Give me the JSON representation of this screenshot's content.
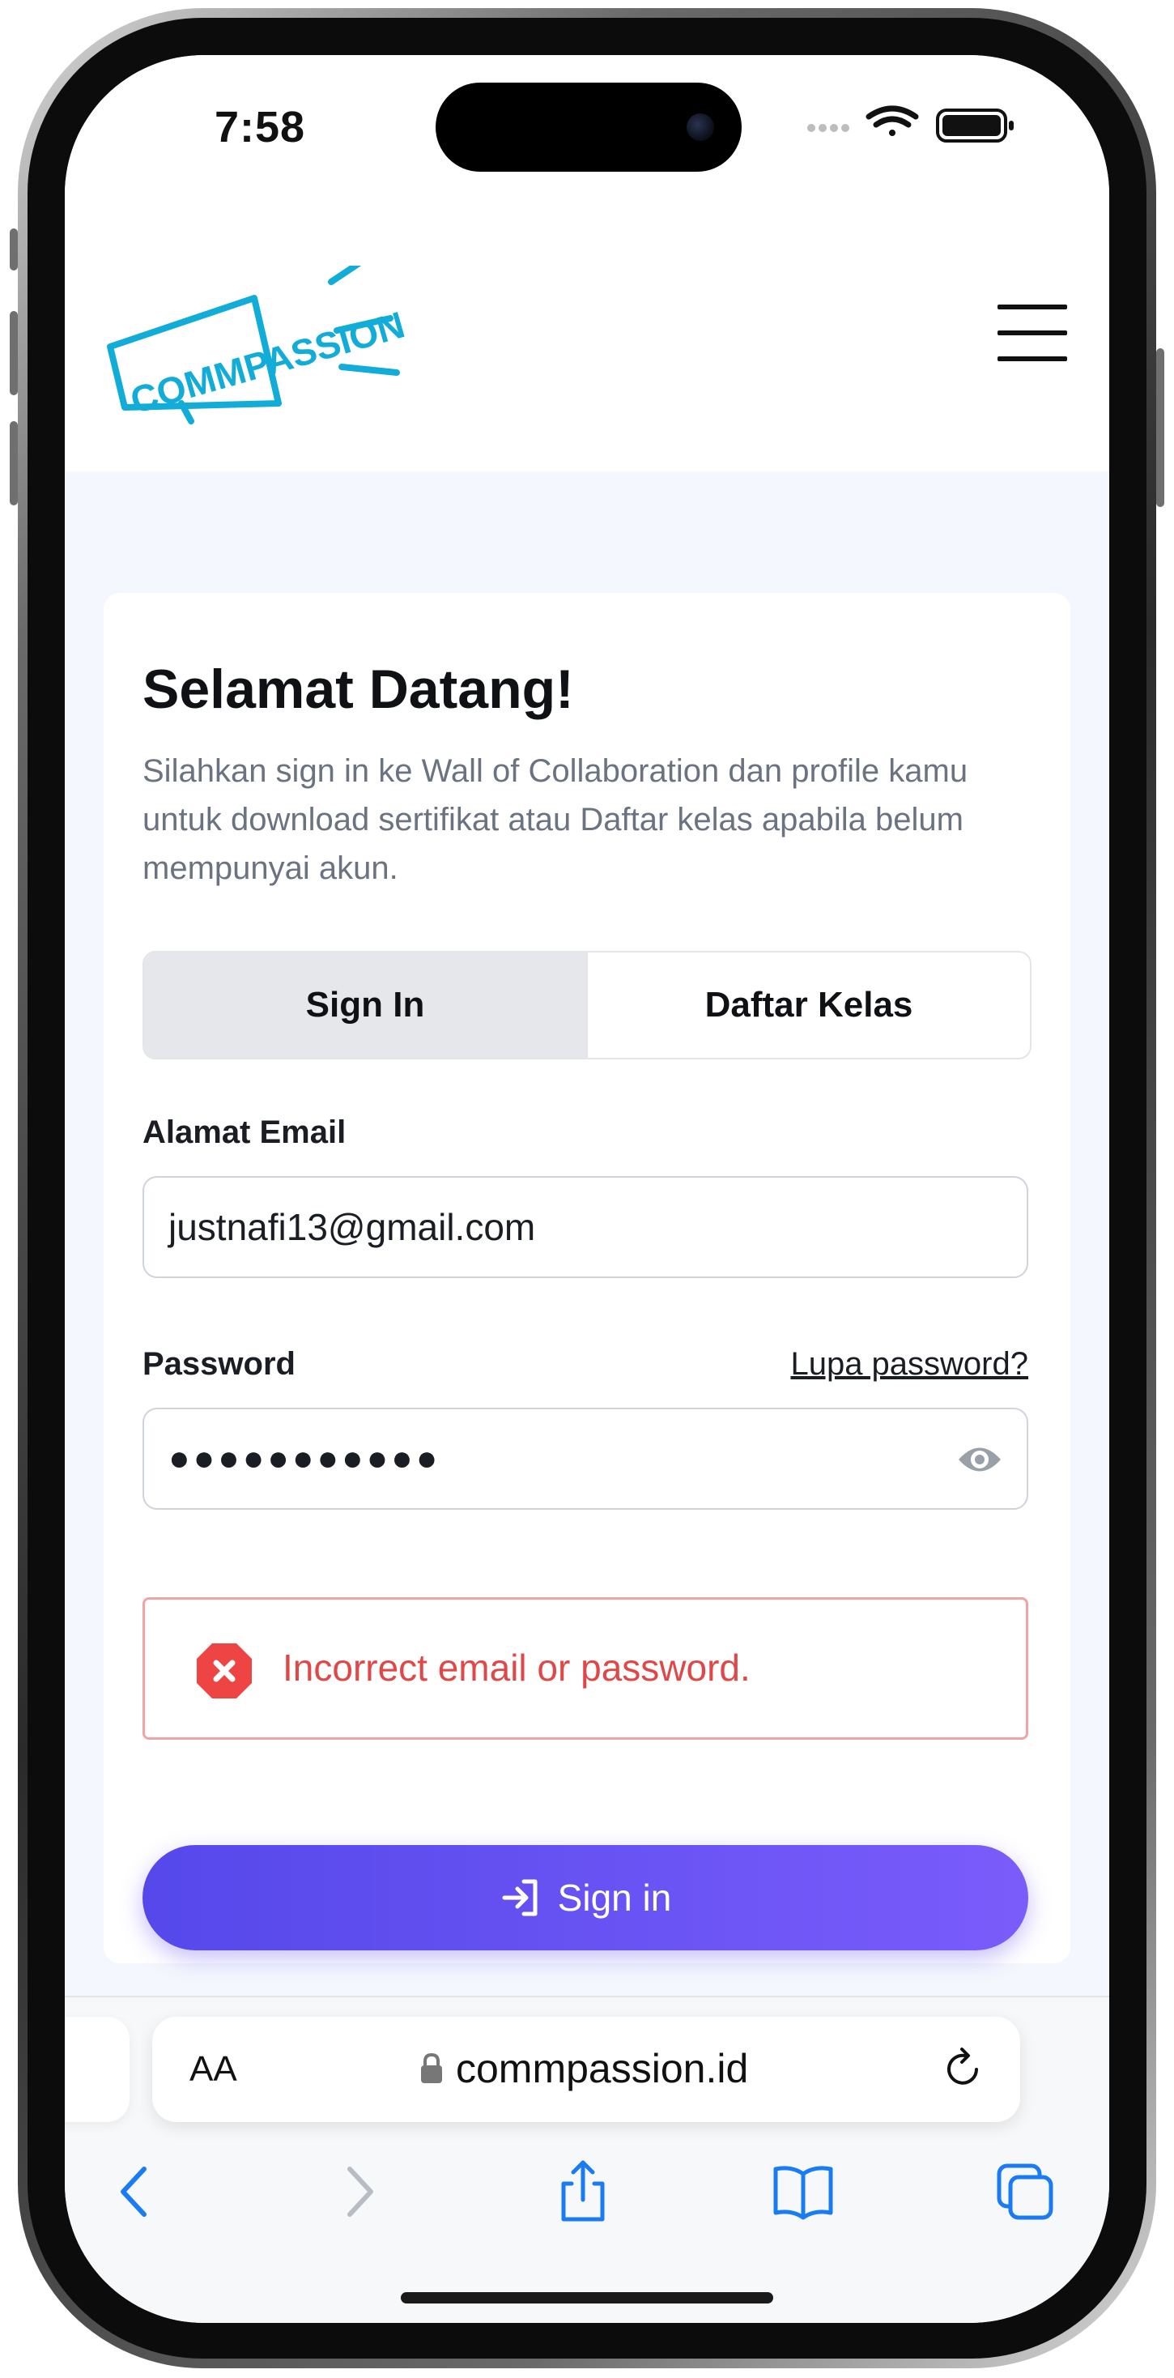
{
  "status_bar": {
    "time": "7:58"
  },
  "header": {
    "logo_text": "COMMPASSION"
  },
  "card": {
    "title": "Selamat Datang!",
    "subtitle": "Silahkan sign in ke Wall of Collaboration dan profile kamu untuk download sertifikat atau Daftar kelas apabila belum mempunyai akun.",
    "tabs": [
      {
        "label": "Sign In",
        "active": true
      },
      {
        "label": "Daftar Kelas",
        "active": false
      }
    ],
    "email": {
      "label": "Alamat Email",
      "value": "justnafi13@gmail.com"
    },
    "password": {
      "label": "Password",
      "forgot_link": "Lupa password?",
      "masked_value": "●●●●●●●●●●●"
    },
    "error": {
      "message": "Incorrect email or password."
    },
    "submit": {
      "label": "Sign in"
    }
  },
  "browser": {
    "text_size_label": "AA",
    "domain": "commpassion.id"
  },
  "colors": {
    "accent": "#6650f5",
    "logo": "#12acd8",
    "error": "#e04848",
    "error_border": "#f2a4a4"
  }
}
